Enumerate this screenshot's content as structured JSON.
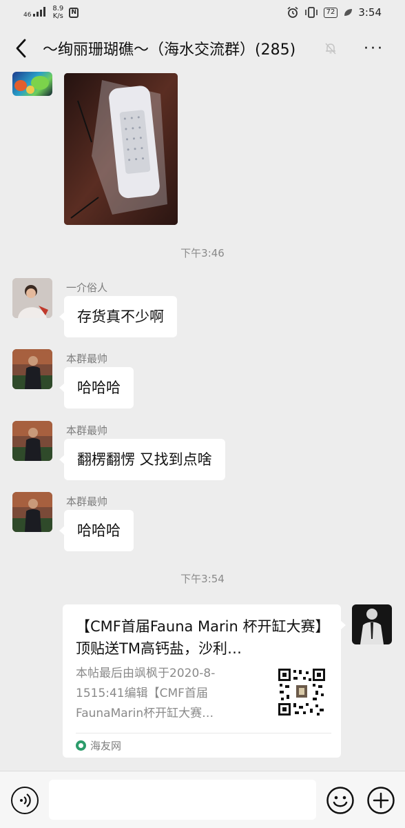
{
  "status_bar": {
    "signal": "46",
    "speed_value": "8.9",
    "speed_unit": "K/s",
    "nfc": "N",
    "battery": "72",
    "time": "3:54"
  },
  "header": {
    "title": "～绚丽珊瑚礁～（海水交流群）(285)",
    "back_icon": "chevron-left-icon",
    "muted_icon": "bell-off-icon",
    "more_icon": "more-icon",
    "more_label": "···"
  },
  "messages": [
    {
      "type": "image",
      "sender": "",
      "image_desc": "led-light-in-plastic-bag"
    },
    {
      "type": "time",
      "text": "下午3:46"
    },
    {
      "type": "text",
      "sender": "一介俗人",
      "text": "存货真不少啊"
    },
    {
      "type": "text",
      "sender": "本群最帅",
      "text": "哈哈哈"
    },
    {
      "type": "text",
      "sender": "本群最帅",
      "text": "翻楞翻愣 又找到点啥"
    },
    {
      "type": "text",
      "sender": "本群最帅",
      "text": "哈哈哈"
    },
    {
      "type": "time",
      "text": "下午3:54"
    },
    {
      "type": "link_card",
      "title": "【CMF首届Fauna Marin 杯开缸大赛】顶贴送TM高钙盐，沙利…",
      "description": "本帖最后由飒枫于2020-8-1515:41编辑【CMF首届FaunaMarin杯开缸大赛…",
      "source": "海友网"
    }
  ],
  "input_bar": {
    "placeholder": "",
    "voice_icon": "voice-icon",
    "emoji_icon": "emoji-icon",
    "plus_icon": "plus-icon"
  }
}
